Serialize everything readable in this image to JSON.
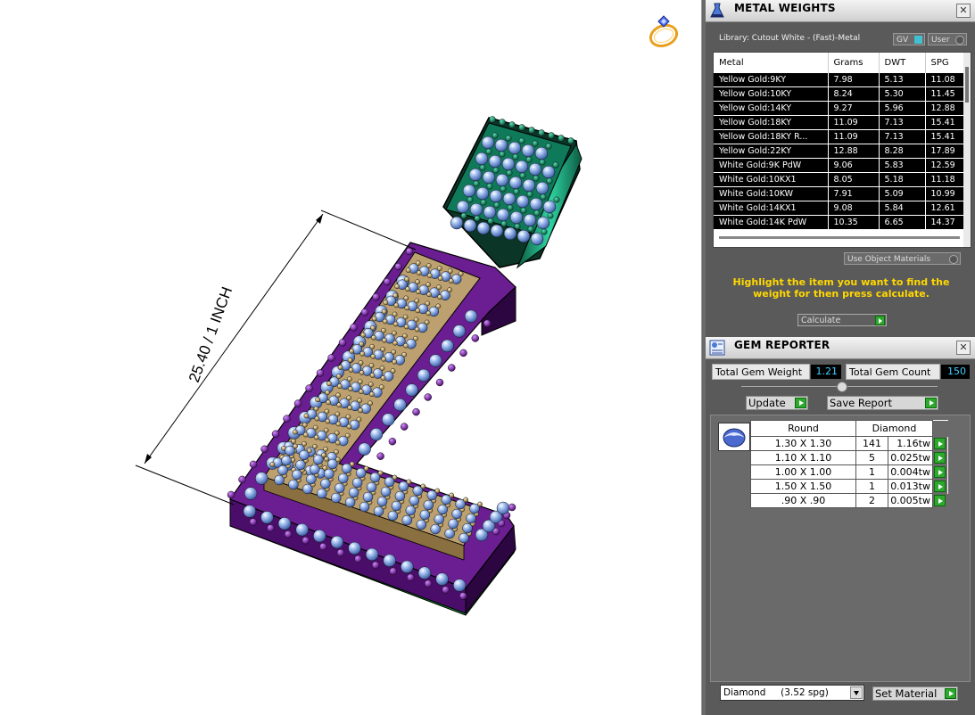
{
  "viewport": {
    "dimension_label": "25.40 / 1 INCH",
    "icons": {
      "ring": "ring-icon"
    }
  },
  "metal_weights": {
    "title": "METAL WEIGHTS",
    "library_label": "Library: Cutout White - (Fast)-Metal",
    "gv_toggle": "GV",
    "user_toggle": "User",
    "columns": [
      "Metal",
      "Grams",
      "DWT",
      "SPG"
    ],
    "rows": [
      [
        "Yellow Gold:9KY",
        "7.98",
        "5.13",
        "11.08"
      ],
      [
        "Yellow Gold:10KY",
        "8.24",
        "5.30",
        "11.45"
      ],
      [
        "Yellow Gold:14KY",
        "9.27",
        "5.96",
        "12.88"
      ],
      [
        "Yellow Gold:18KY",
        "11.09",
        "7.13",
        "15.41"
      ],
      [
        "Yellow Gold:18KY R...",
        "11.09",
        "7.13",
        "15.41"
      ],
      [
        "Yellow Gold:22KY",
        "12.88",
        "8.28",
        "17.89"
      ],
      [
        "White Gold:9K PdW",
        "9.06",
        "5.83",
        "12.59"
      ],
      [
        "White Gold:10KX1",
        "8.05",
        "5.18",
        "11.18"
      ],
      [
        "White Gold:10KW",
        "7.91",
        "5.09",
        "10.99"
      ],
      [
        "White Gold:14KX1",
        "9.08",
        "5.84",
        "12.61"
      ],
      [
        "White Gold:14K PdW",
        "10.35",
        "6.65",
        "14.37"
      ]
    ],
    "use_object_materials": "Use Object Materials",
    "instruction": "Highlight the item you want to find the weight for then press calculate.",
    "calculate_button": "Calculate"
  },
  "gem_reporter": {
    "title": "GEM REPORTER",
    "total_weight_label": "Total Gem Weight",
    "total_weight_value": "1.21",
    "total_count_label": "Total Gem Count",
    "total_count_value": "150",
    "update_button": "Update",
    "save_report_button": "Save Report",
    "table_headers": [
      "Round",
      "Diamond"
    ],
    "rows": [
      [
        "1.30 X 1.30",
        "141",
        "1.16tw"
      ],
      [
        "1.10 X 1.10",
        "5",
        "0.025tw"
      ],
      [
        "1.00 X 1.00",
        "1",
        "0.004tw"
      ],
      [
        "1.50 X 1.50",
        "1",
        "0.013tw"
      ],
      [
        ".90 X .90",
        "2",
        "0.005tw"
      ]
    ],
    "material_select": "Diamond     (3.52 spg)",
    "set_material_button": "Set Material"
  },
  "colors": {
    "panel_bg": "#5a5a5a",
    "highlight_text": "#ffd800",
    "value_text": "#40d0ff",
    "go_arrow": "#2ea82e",
    "purple_metal": "#6a1a8a",
    "gold_metal": "#c8a870",
    "green_bail": "#12906e"
  }
}
